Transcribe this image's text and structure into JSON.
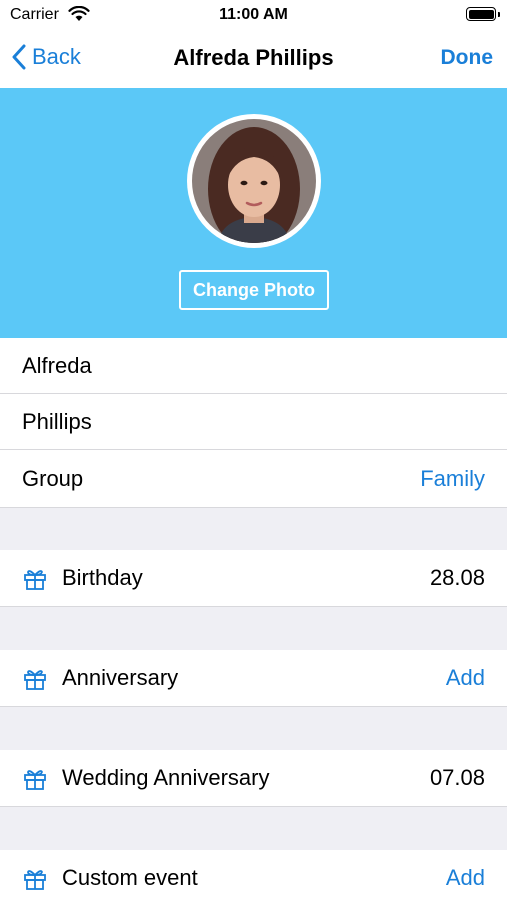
{
  "status_bar": {
    "carrier": "Carrier",
    "time": "11:00 AM"
  },
  "nav": {
    "back_label": "Back",
    "title": "Alfreda Phillips",
    "done_label": "Done"
  },
  "header": {
    "change_photo_label": "Change Photo"
  },
  "fields": {
    "first_name": "Alfreda",
    "last_name": "Phillips"
  },
  "group": {
    "label": "Group",
    "value": "Family"
  },
  "events": [
    {
      "label": "Birthday",
      "value": "28.08"
    },
    {
      "label": "Anniversary",
      "action": "Add"
    },
    {
      "label": "Wedding Anniversary",
      "value": "07.08"
    },
    {
      "label": "Custom event",
      "action": "Add"
    }
  ],
  "colors": {
    "accent": "#1a7fd8",
    "header_bg": "#5bc8f7",
    "section_bg": "#efeff4"
  },
  "icons": {
    "gift": "gift-icon",
    "back": "chevron-left-icon",
    "wifi": "wifi-icon",
    "battery": "battery-icon"
  }
}
